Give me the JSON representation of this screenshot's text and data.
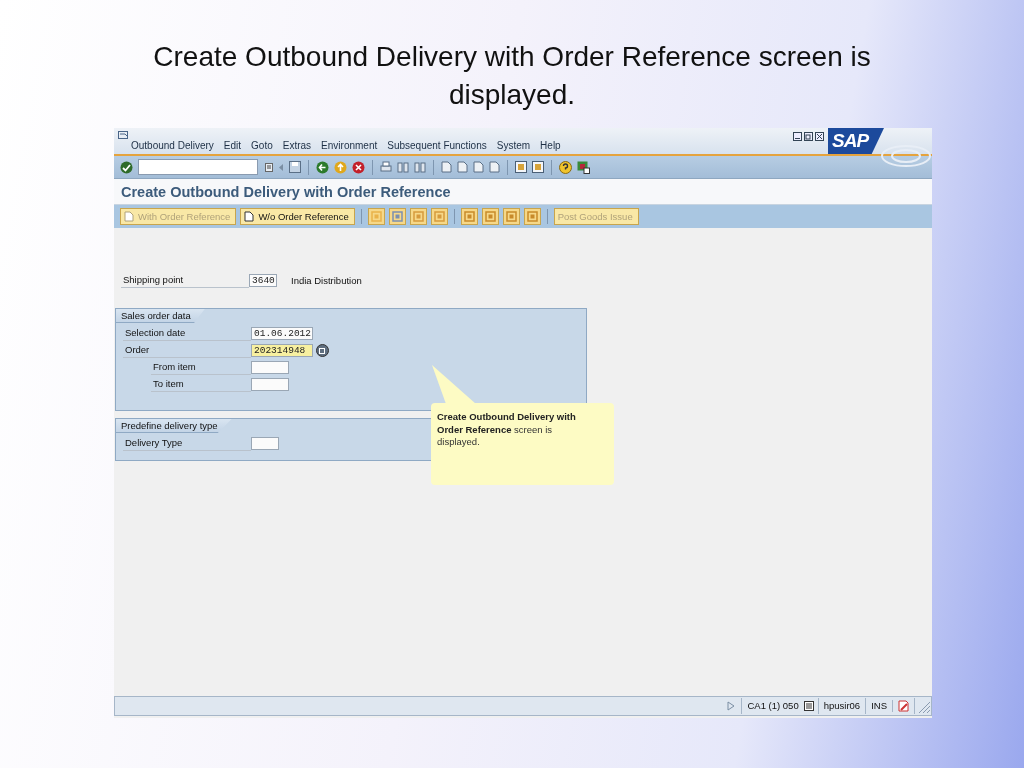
{
  "slide_title": "Create Outbound Delivery with Order Reference screen is displayed.",
  "window": {
    "menu": [
      "Outbound Delivery",
      "Edit",
      "Goto",
      "Extras",
      "Environment",
      "Subsequent Functions",
      "System",
      "Help"
    ],
    "logo": "SAP",
    "title": "Create Outbound Delivery with Order Reference"
  },
  "app_toolbar": [
    {
      "kind": "document",
      "label": "With Order Reference",
      "disabled": true
    },
    {
      "kind": "document",
      "label": "W/o Order Reference",
      "disabled": false
    },
    {
      "kind": "text",
      "label": "Post Goods Issue",
      "disabled": true
    }
  ],
  "header_field": {
    "label": "Shipping point",
    "value": "3640",
    "kind": "code",
    "description": "India Distribution"
  },
  "groups": [
    {
      "title": "Sales order data",
      "fields": [
        {
          "label": "Selection date",
          "value": "01.06.2012",
          "kind": "date",
          "focused": false
        },
        {
          "label": "Order",
          "value": "202314948",
          "kind": "document",
          "focused": true,
          "value_help": true,
          "children": [
            {
              "label": "From item",
              "kind": "item",
              "focused": false
            },
            {
              "label": "To item",
              "kind": "item",
              "focused": false
            }
          ]
        }
      ]
    },
    {
      "title": "Predefine delivery type",
      "fields": [
        {
          "label": "Delivery Type",
          "kind": "code",
          "focused": false
        }
      ]
    }
  ],
  "callout": "**Create Outbound Delivery with Order Reference** screen is displayed.",
  "status_bar": {
    "system": "CA1 (1) 050",
    "host": "hpusir06",
    "mode": "INS"
  }
}
